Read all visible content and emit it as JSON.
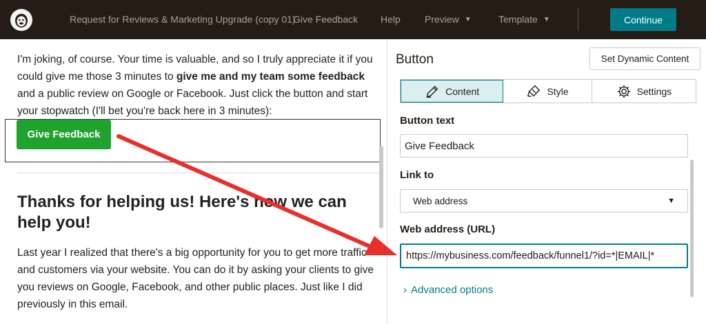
{
  "topbar": {
    "campaign_name": "Request for Reviews & Marketing Upgrade (copy 01)",
    "nav": {
      "give_feedback": "Give Feedback",
      "help": "Help",
      "preview": "Preview",
      "template": "Template"
    },
    "continue_label": "Continue",
    "accent_color": "#007c89",
    "background_color": "#241c15"
  },
  "preview": {
    "para1_before": "I'm joking, of course. Your time is valuable, and so I truly appreciate it if you could give me those 3 minutes to ",
    "para1_bold": "give me and my team some feedback",
    "para1_after": " and a public review on Google or Facebook. Just click the button and start your stopwatch (I'll bet you're back here in 3 minutes):",
    "button_label": "Give Feedback",
    "button_color": "#1fa22e",
    "heading": "Thanks for helping us! Here's how we can help you!",
    "para2": "Last year I realized that there's a big opportunity for you to get more traffic and customers via your website. You can do it by asking your clients to give you reviews on Google, Facebook, and other public places. Just like I did previously in this email."
  },
  "panel": {
    "title": "Button",
    "dynamic_content_label": "Set Dynamic Content",
    "tabs": [
      {
        "label": "Content",
        "icon": "pencil-icon",
        "active": true
      },
      {
        "label": "Style",
        "icon": "paint-icon",
        "active": false
      },
      {
        "label": "Settings",
        "icon": "gear-icon",
        "active": false
      }
    ],
    "button_text_label": "Button text",
    "button_text_value": "Give Feedback",
    "link_to_label": "Link to",
    "link_to_value": "Web address",
    "url_label": "Web address (URL)",
    "url_value": "https://mybusiness.com/feedback/funnel1/?id=*|EMAIL|*",
    "advanced_label": "Advanced options"
  },
  "annotation": {
    "arrow_color": "#e8302a"
  }
}
